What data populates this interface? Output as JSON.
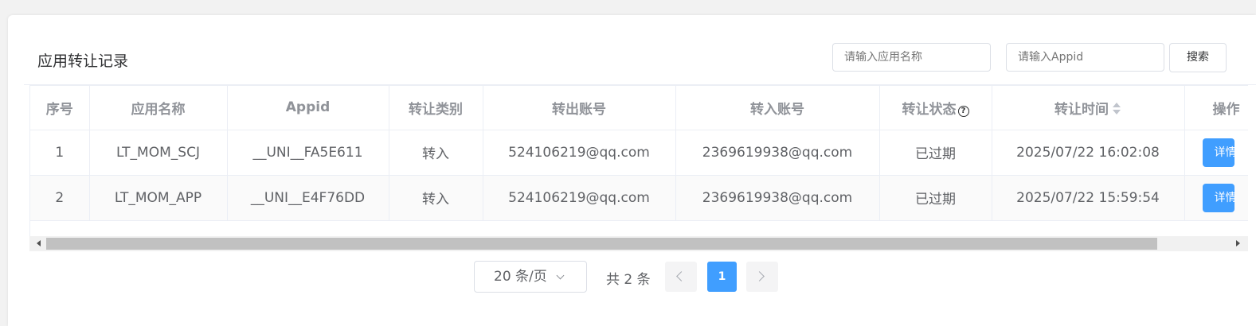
{
  "page_title": "应用转让记录",
  "search": {
    "app_name_placeholder": "请输入应用名称",
    "appid_placeholder": "请输入Appid",
    "button_label": "搜索"
  },
  "table": {
    "columns": [
      "序号",
      "应用名称",
      "Appid",
      "转让类别",
      "转出账号",
      "转入账号",
      "转让状态",
      "转让时间",
      "操作"
    ],
    "rows": [
      [
        "1",
        "LT_MOM_SCJ",
        "__UNI__FA5E611",
        "转入",
        "524106219@qq.com",
        "2369619938@qq.com",
        "已过期",
        "2025/07/22 16:02:08",
        "详情"
      ],
      [
        "2",
        "LT_MOM_APP",
        "__UNI__E4F76DD",
        "转入",
        "524106219@qq.com",
        "2369619938@qq.com",
        "已过期",
        "2025/07/22 15:59:54",
        "详情"
      ]
    ],
    "status_help_icon": "question-circle-icon",
    "sort_icon": "sort-caret-icon"
  },
  "pagination": {
    "page_size_label": "20 条/页",
    "total_label": "共 2 条",
    "current_page": "1"
  },
  "colors": {
    "primary": "#409eff",
    "border": "#dcdfe6",
    "header_text": "#909399",
    "body_text": "#606266"
  }
}
